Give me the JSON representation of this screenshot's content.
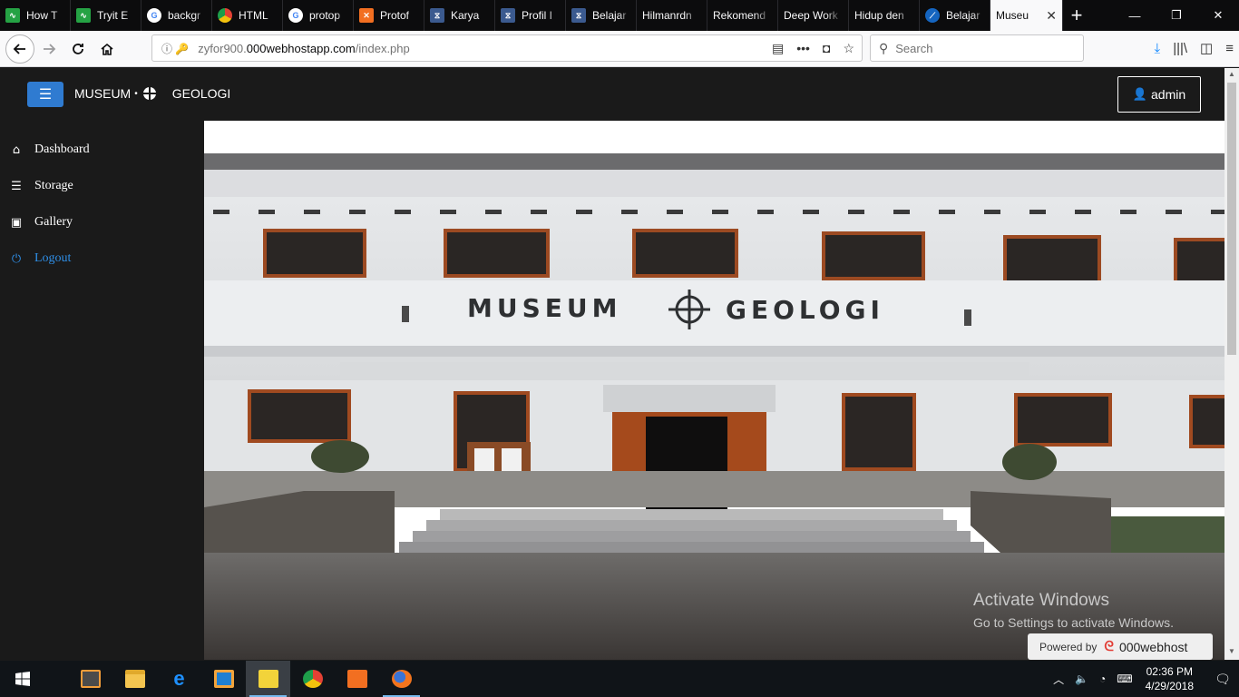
{
  "browser": {
    "tabs": [
      {
        "label": "How T",
        "icon": "site-icon",
        "color": "#25a244"
      },
      {
        "label": "Tryit E",
        "icon": "site-icon",
        "color": "#25a244"
      },
      {
        "label": "backgr",
        "icon": "google-icon",
        "color": "#ffffff"
      },
      {
        "label": "HTML",
        "icon": "chrome-icon",
        "color": "#e44134"
      },
      {
        "label": "protop",
        "icon": "google-icon",
        "color": "#ffffff"
      },
      {
        "label": "Protof",
        "icon": "xampp-icon",
        "color": "#f26f21"
      },
      {
        "label": "Karya",
        "icon": "site-icon",
        "color": "#3b5a8f"
      },
      {
        "label": "Profil I",
        "icon": "site-icon",
        "color": "#3b5a8f"
      },
      {
        "label": "Belajar",
        "icon": "site-icon",
        "color": "#3b5a8f"
      },
      {
        "label": "Hilmanrdn",
        "icon": "",
        "color": ""
      },
      {
        "label": "Rekomend",
        "icon": "",
        "color": ""
      },
      {
        "label": "Deep Work",
        "icon": "",
        "color": ""
      },
      {
        "label": "Hidup den",
        "icon": "",
        "color": ""
      },
      {
        "label": "Belajar",
        "icon": "site-icon",
        "color": "#1565c0"
      }
    ],
    "active_tab": {
      "label": "Museu",
      "close": "✕"
    },
    "new_tab": "+",
    "window": {
      "minimize": "—",
      "maximize": "❐",
      "close": "✕"
    },
    "url_prefix": "zyfor900.",
    "url_host": "000webhostapp.com",
    "url_path": "/index.php",
    "search_placeholder": "Search"
  },
  "site": {
    "brand_left": "MUSEUM",
    "brand_right": "GEOLOGI",
    "user_label": "admin",
    "menu_colors": {
      "menu_button": "#2f7bd1",
      "logout": "#2f8fe8"
    },
    "sidebar": [
      {
        "label": "Dashboard",
        "icon": "home-icon"
      },
      {
        "label": "Storage",
        "icon": "list-icon"
      },
      {
        "label": "Gallery",
        "icon": "image-icon"
      },
      {
        "label": "Logout",
        "icon": "power-icon"
      }
    ],
    "hero_signage": "MUSEUM  GEOLOGI"
  },
  "overlay": {
    "activate_title": "Activate Windows",
    "activate_sub": "Go to Settings to activate Windows.",
    "powered_by": "Powered by",
    "host_brand": "000webhost"
  },
  "taskbar": {
    "time": "02:36 PM",
    "date": "4/29/2018"
  }
}
